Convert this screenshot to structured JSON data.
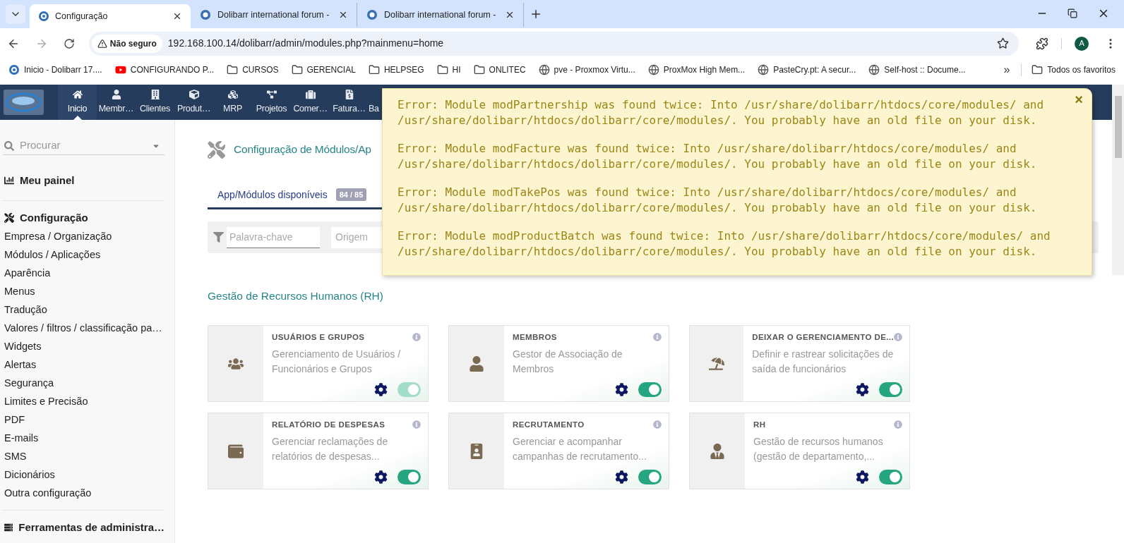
{
  "browser": {
    "tabs": [
      {
        "title": "Configuração",
        "kind": "dolibarr",
        "selected": true
      },
      {
        "title": "Dolibarr international forum -",
        "kind": "forum",
        "selected": false
      },
      {
        "title": "Dolibarr international forum -",
        "kind": "forum",
        "selected": false
      }
    ],
    "address": {
      "security": "Não seguro",
      "url": "192.168.100.14/dolibarr/admin/modules.php?mainmenu=home"
    },
    "profile_initial": "A",
    "bookmarks": [
      {
        "label": "Inicio - Dolibarr 17....",
        "kind": "dolibarr"
      },
      {
        "label": "CONFIGURANDO P...",
        "kind": "video"
      },
      {
        "label": "CURSOS",
        "kind": "folder"
      },
      {
        "label": "GERENCIAL",
        "kind": "folder"
      },
      {
        "label": "HELPSEG",
        "kind": "folder"
      },
      {
        "label": "HI",
        "kind": "folder"
      },
      {
        "label": "ONLITEC",
        "kind": "folder"
      },
      {
        "label": "pve - Proxmox Virtu...",
        "kind": "globe"
      },
      {
        "label": "ProxMox High Mem...",
        "kind": "globe"
      },
      {
        "label": "PasteCry.pt: A secur...",
        "kind": "globe"
      },
      {
        "label": "Self-host :: Docume...",
        "kind": "globe"
      }
    ],
    "more": "»",
    "all_bookmarks": "Todos os favoritos"
  },
  "app_nav": [
    {
      "label": "Inicio",
      "kind": "home",
      "selected": true
    },
    {
      "label": "Membr…",
      "kind": "user",
      "selected": false
    },
    {
      "label": "Clientes",
      "kind": "building",
      "selected": false
    },
    {
      "label": "Produt…",
      "kind": "cube",
      "selected": false
    },
    {
      "label": "MRP",
      "kind": "cubes",
      "selected": false
    },
    {
      "label": "Projetos",
      "kind": "diagram",
      "selected": false
    },
    {
      "label": "Comer…",
      "kind": "suitcase",
      "selected": false
    },
    {
      "label": "Fatura…",
      "kind": "invoice",
      "selected": false
    },
    {
      "label": "Ba",
      "kind": "partial",
      "selected": false
    }
  ],
  "sidebar": {
    "search_placeholder": "Procurar",
    "sections": [
      {
        "title": "Meu painel",
        "kind": "chart"
      },
      {
        "title": "Configuração",
        "kind": "tools",
        "items": [
          "Empresa / Organização",
          "Módulos / Aplicações",
          "Aparência",
          "Menus",
          "Tradução",
          "Valores / filtros / classificação pa…",
          "Widgets",
          "Alertas",
          "Segurança",
          "Limites e Precisão",
          "PDF",
          "E-mails",
          "SMS",
          "Dicionários",
          "Outra configuração"
        ]
      },
      {
        "title": "Ferramentas de administra…",
        "kind": "server"
      }
    ]
  },
  "main": {
    "title": "Configuração de Módulos/Ap",
    "tabs": [
      {
        "label": "App/Módulos disponíveis",
        "badge": "84 / 85",
        "selected": true
      }
    ],
    "filters": {
      "keyword_placeholder": "Palavra-chave",
      "origin_placeholder": "Origem"
    },
    "section_title": "Gestão de Recursos Humanos (RH)",
    "modules": [
      {
        "title": "USUÁRIOS E GRUPOS",
        "description": "Gerenciamento de Usuários / Funcionários e Grupos",
        "kind": "users",
        "on": true,
        "disabled": true
      },
      {
        "title": "MEMBROS",
        "description": "Gestor de Associação de Membros",
        "kind": "user",
        "on": true,
        "disabled": false
      },
      {
        "title": "DEIXAR O GERENCIAMENTO DE...",
        "description": "Definir e rastrear solicitações de saída de funcionários",
        "kind": "beach",
        "on": true,
        "disabled": false
      },
      {
        "title": "RELATÓRIO DE DESPESAS",
        "description": "Gerenciar reclamações de relatórios de despesas...",
        "kind": "wallet",
        "on": true,
        "disabled": false
      },
      {
        "title": "RECRUTAMENTO",
        "description": "Gerenciar e acompanhar campanhas de recrutamento...",
        "kind": "badge",
        "on": true,
        "disabled": false
      },
      {
        "title": "RH",
        "description": "Gestão de recursos humanos (gestão de departamento,...",
        "kind": "usertie",
        "on": true,
        "disabled": false
      }
    ]
  },
  "error_popup": {
    "messages": [
      "Error: Module modPartnership was found twice: Into /usr/share/dolibarr/htdocs/core/modules/ and /usr/share/dolibarr/htdocs/dolibarr/core/modules/. You probably have an old file on your disk.",
      "Error: Module modFacture was found twice: Into /usr/share/dolibarr/htdocs/core/modules/ and /usr/share/dolibarr/htdocs/dolibarr/core/modules/. You probably have an old file on your disk.",
      "Error: Module modTakePos was found twice: Into /usr/share/dolibarr/htdocs/core/modules/ and /usr/share/dolibarr/htdocs/dolibarr/core/modules/. You probably have an old file on your disk.",
      "Error: Module modProductBatch was found twice: Into /usr/share/dolibarr/htdocs/core/modules/ and /usr/share/dolibarr/htdocs/dolibarr/core/modules/. You probably have an old file on your disk."
    ],
    "close": "×"
  }
}
